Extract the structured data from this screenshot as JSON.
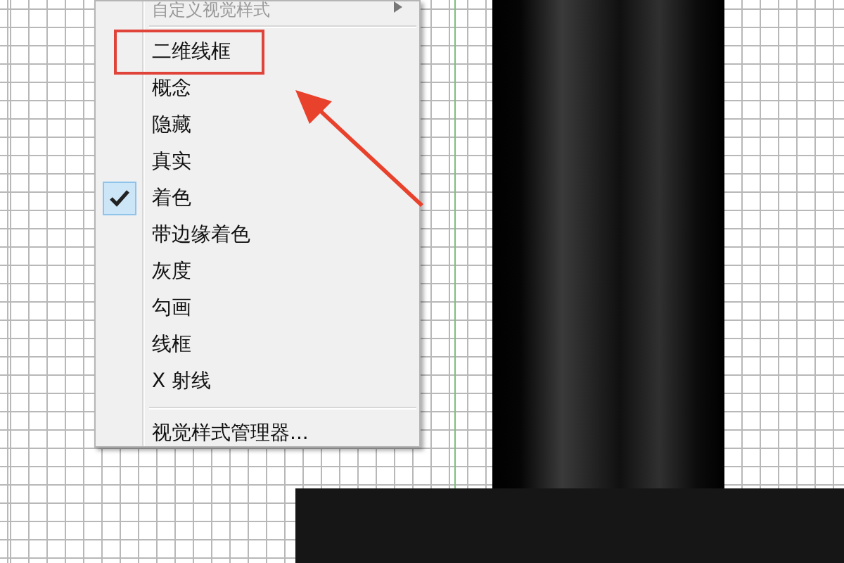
{
  "context_menu": {
    "items": [
      {
        "kind": "item",
        "label": "自定义视觉样式",
        "checked": false,
        "submenu": true,
        "highlighted": false
      },
      {
        "kind": "separator"
      },
      {
        "kind": "item",
        "label": "二维线框",
        "checked": false,
        "submenu": false,
        "highlighted": true
      },
      {
        "kind": "item",
        "label": "概念",
        "checked": false,
        "submenu": false,
        "highlighted": false
      },
      {
        "kind": "item",
        "label": "隐藏",
        "checked": false,
        "submenu": false,
        "highlighted": false
      },
      {
        "kind": "item",
        "label": "真实",
        "checked": false,
        "submenu": false,
        "highlighted": false
      },
      {
        "kind": "item",
        "label": "着色",
        "checked": true,
        "submenu": false,
        "highlighted": false
      },
      {
        "kind": "item",
        "label": "带边缘着色",
        "checked": false,
        "submenu": false,
        "highlighted": false
      },
      {
        "kind": "item",
        "label": "灰度",
        "checked": false,
        "submenu": false,
        "highlighted": false
      },
      {
        "kind": "item",
        "label": "勾画",
        "checked": false,
        "submenu": false,
        "highlighted": false
      },
      {
        "kind": "item",
        "label": "线框",
        "checked": false,
        "submenu": false,
        "highlighted": false
      },
      {
        "kind": "item",
        "label": "X 射线",
        "checked": false,
        "submenu": false,
        "highlighted": false
      },
      {
        "kind": "separator"
      },
      {
        "kind": "item",
        "label": "视觉样式管理器...",
        "checked": false,
        "submenu": false,
        "highlighted": false
      }
    ]
  }
}
